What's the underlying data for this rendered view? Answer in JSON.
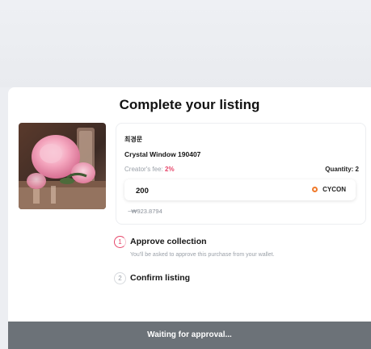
{
  "modal": {
    "title": "Complete your listing",
    "item": {
      "artist": "최경문",
      "name": "Crystal Window 190407",
      "creator_fee_label": "Creator's fee:",
      "creator_fee_value": "2%",
      "quantity_label": "Quantity: 2"
    },
    "price": {
      "value": "200",
      "currency": "CYCON",
      "currency_icon": "cycon-coin-icon",
      "krw_estimate": "~₩923.8794"
    },
    "steps": [
      {
        "number": "1",
        "title": "Approve collection",
        "description": "You'll be asked to approve this purchase from your wallet."
      },
      {
        "number": "2",
        "title": "Confirm listing"
      }
    ],
    "footer_button": "Waiting for approval..."
  },
  "colors": {
    "accent": "#e6466a",
    "currency": "#f07a2b",
    "footer": "#6c7278"
  }
}
